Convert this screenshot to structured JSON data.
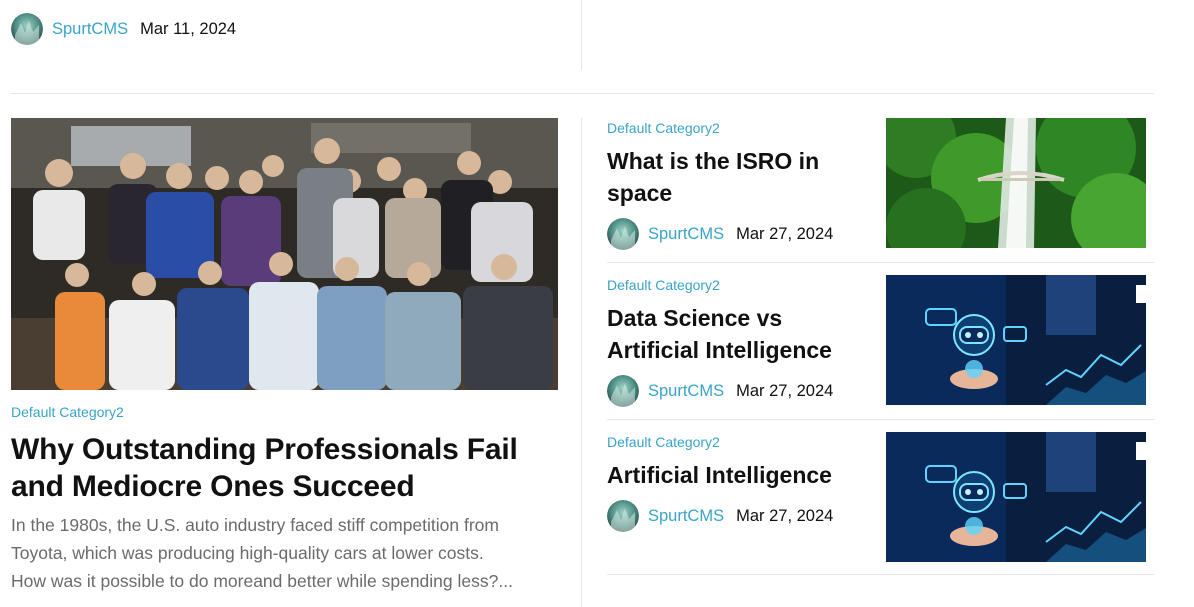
{
  "top_post": {
    "author": "SpurtCMS",
    "date": "Mar 11, 2024"
  },
  "featured": {
    "category": "Default Category2",
    "title_line1": "Why Outstanding Professionals Fail",
    "title_line2": "and Mediocre Ones Succeed",
    "excerpt_line1": "In the 1980s, the U.S. auto industry faced stiff competition from",
    "excerpt_line2": "Toyota, which was producing high-quality cars at lower costs.",
    "excerpt_line3": "How was it possible to do moreand better while spending less?..."
  },
  "side_posts": [
    {
      "category": "Default Category2",
      "title_line1": "What is the ISRO in",
      "title_line2": "space",
      "author": "SpurtCMS",
      "date": "Mar 27, 2024",
      "thumb": "waterfall"
    },
    {
      "category": "Default Category2",
      "title_line1": "Data Science vs",
      "title_line2": "Artificial Intelligence",
      "author": "SpurtCMS",
      "date": "Mar 27, 2024",
      "thumb": "ai-robot"
    },
    {
      "category": "Default Category2",
      "title_line1": "Artificial Intelligence",
      "title_line2": "",
      "author": "SpurtCMS",
      "date": "Mar 27, 2024",
      "thumb": "ai-robot"
    }
  ],
  "colors": {
    "accent": "#3aa3c9",
    "title": "#111111",
    "excerpt": "#6b6b6b",
    "divider": "#e6e6e6"
  }
}
